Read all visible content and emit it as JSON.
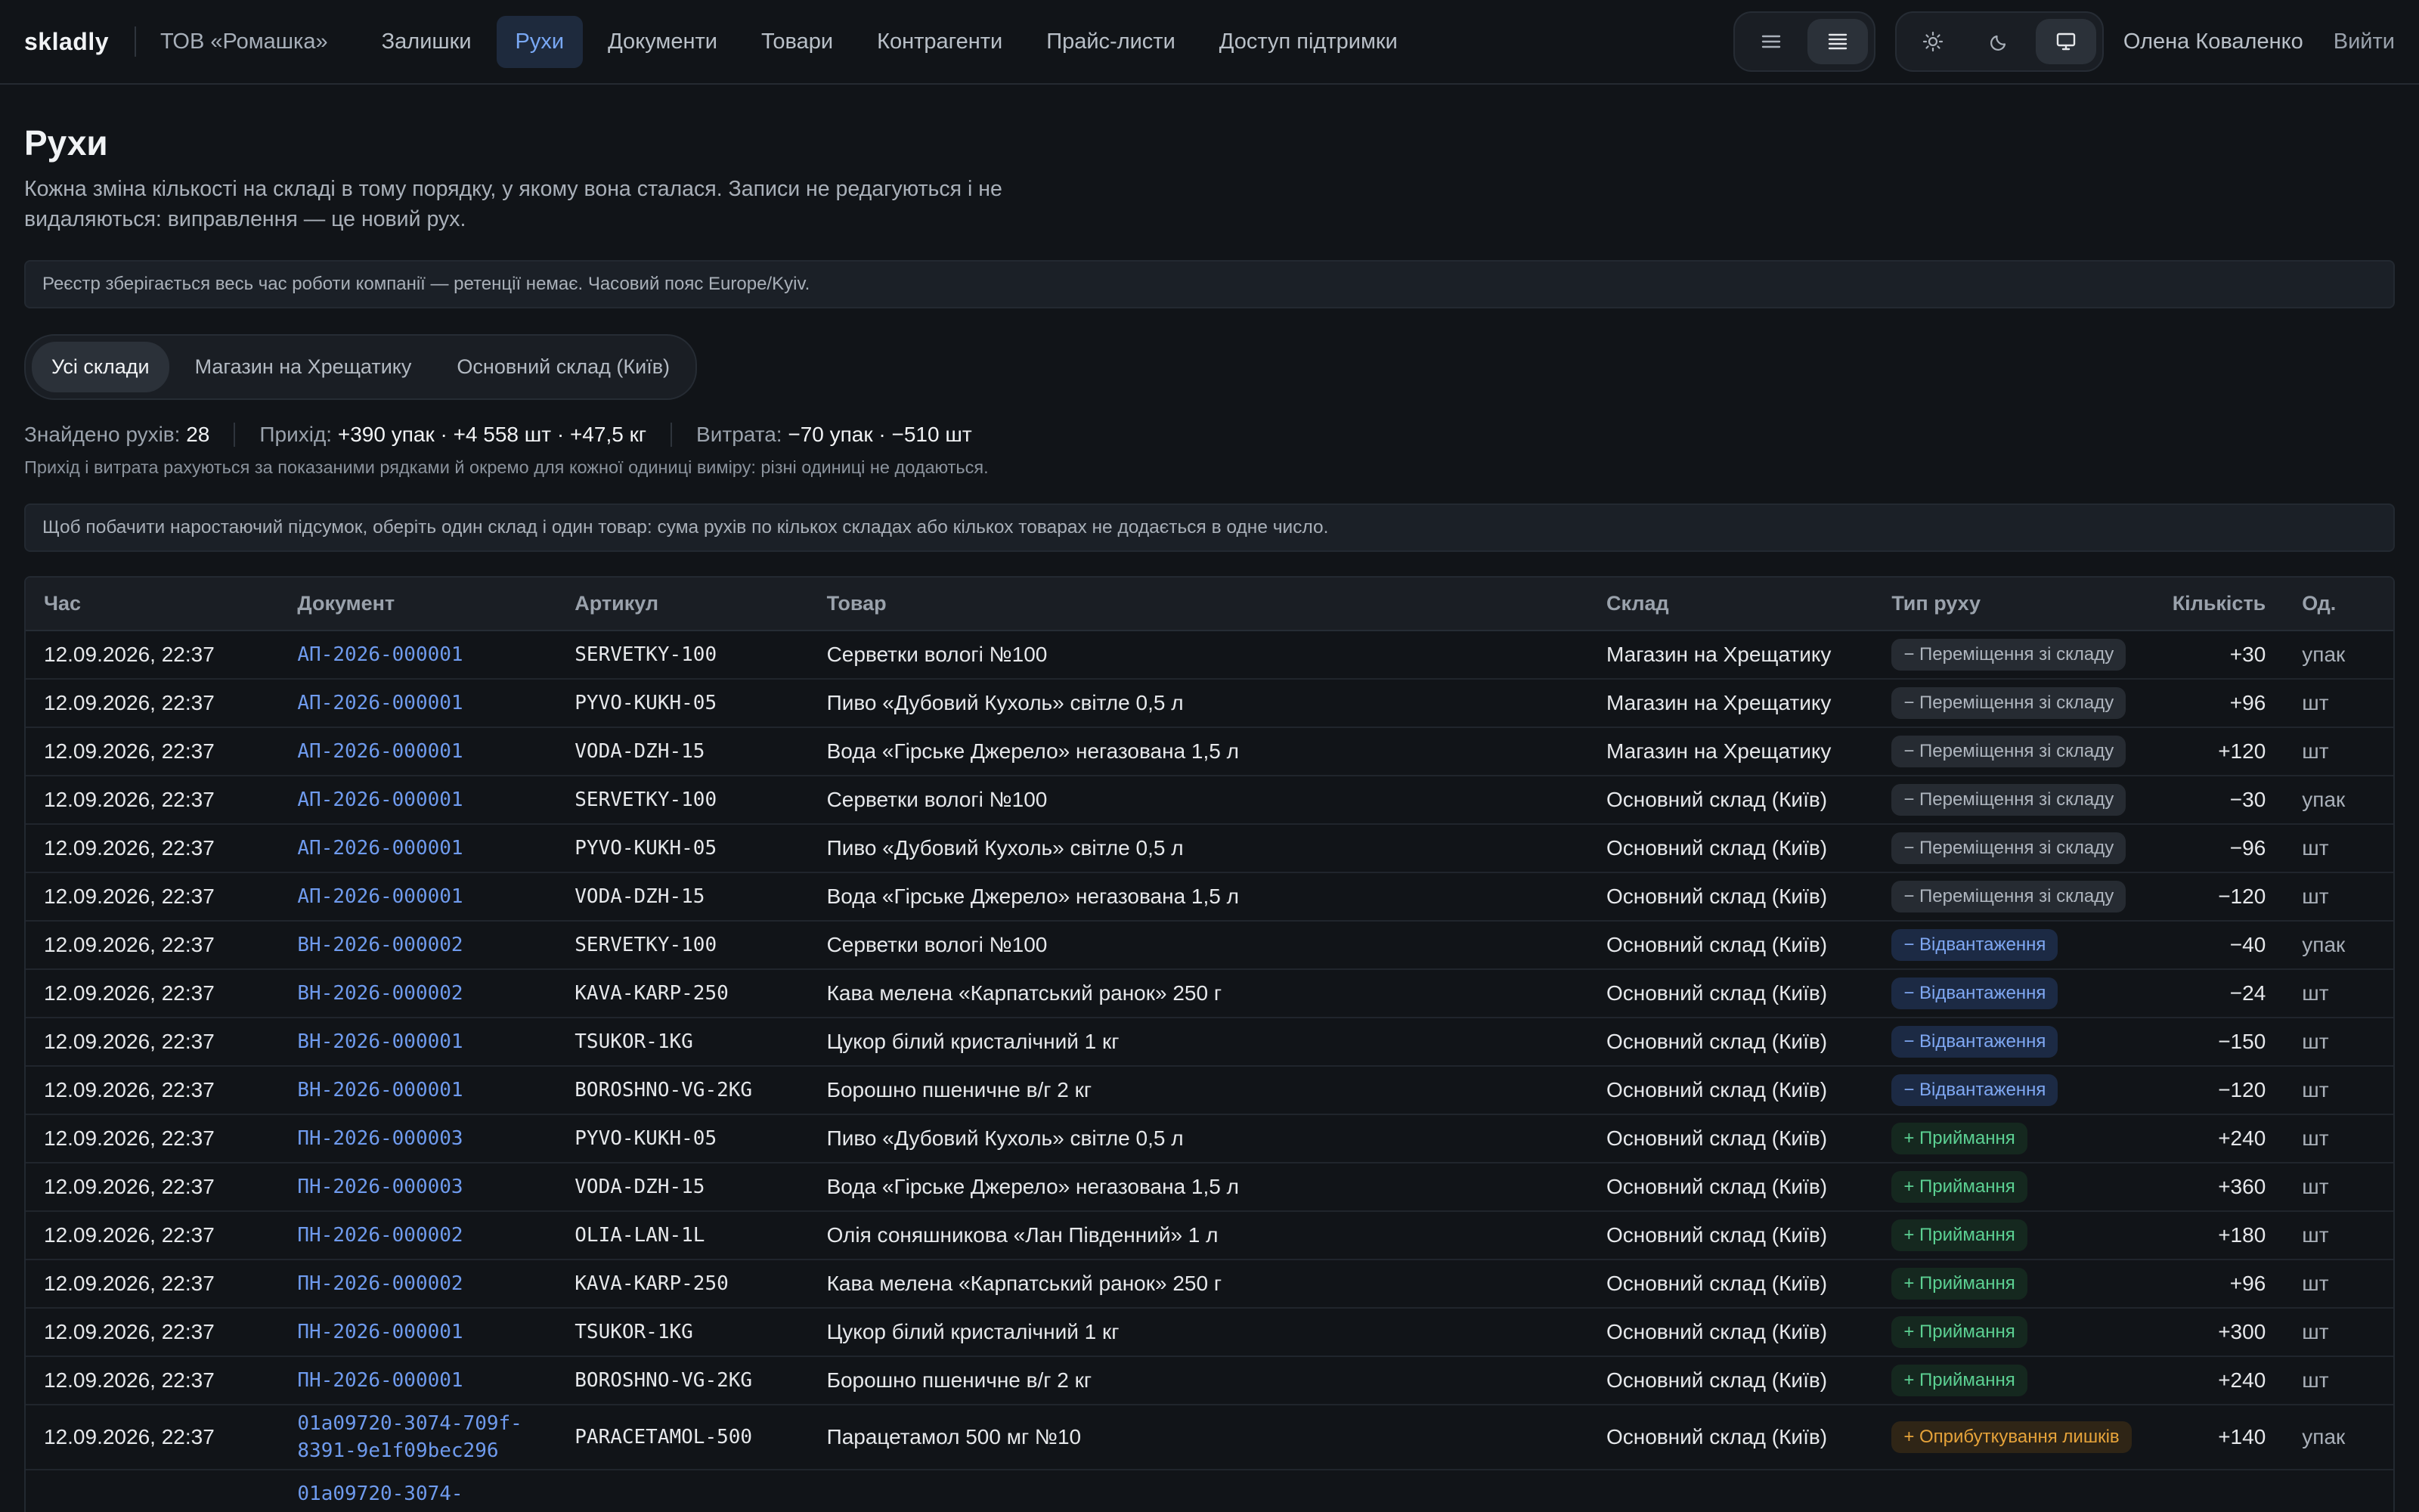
{
  "header": {
    "brand": "skladly",
    "company": "ТОВ «Ромашка»",
    "nav": [
      {
        "label": "Залишки",
        "active": false
      },
      {
        "label": "Рухи",
        "active": true
      },
      {
        "label": "Документи",
        "active": false
      },
      {
        "label": "Товари",
        "active": false
      },
      {
        "label": "Контрагенти",
        "active": false
      },
      {
        "label": "Прайс-листи",
        "active": false
      },
      {
        "label": "Доступ підтримки",
        "active": false
      }
    ],
    "density_icons": [
      "list-compact-icon",
      "list-dense-icon"
    ],
    "density_selected": "list-dense-icon",
    "theme_icons": [
      "sun-icon",
      "moon-icon",
      "monitor-icon"
    ],
    "theme_selected": "monitor-icon",
    "user": "Олена Коваленко",
    "logout": "Вийти"
  },
  "page": {
    "title": "Рухи",
    "subtitle": "Кожна зміна кількості на складі в тому порядку, у якому вона сталася. Записи не редагуються і не видаляються: виправлення — це новий рух.",
    "retention_notice": "Реєстр зберігається весь час роботи компанії — ретенції немає. Часовий пояс Europe/Kyiv.",
    "warehouse_tabs": [
      {
        "label": "Усі склади",
        "active": true
      },
      {
        "label": "Магазин на Хрещатику",
        "active": false
      },
      {
        "label": "Основний склад (Київ)",
        "active": false
      }
    ],
    "stats": {
      "found_label": "Знайдено рухів:",
      "found_value": "28",
      "income_label": "Прихід:",
      "income_value": "+390 упак · +4 558 шт · +47,5 кг",
      "expense_label": "Витрата:",
      "expense_value": "−70 упак · −510 шт"
    },
    "stats_note": "Прихід і витрата рахуються за показаними рядками й окремо для кожної одиниці виміру: різні одиниці не додаються.",
    "running_total_notice": "Щоб побачити наростаючий підсумок, оберіть один склад і один товар: сума рухів по кількох складах або кількох товарах не додається в одне число."
  },
  "table": {
    "columns": {
      "time": "Час",
      "document": "Документ",
      "sku": "Артикул",
      "product": "Товар",
      "warehouse": "Склад",
      "type": "Тип руху",
      "qty": "Кількість",
      "unit": "Од."
    },
    "rows": [
      {
        "time": "12.09.2026, 22:37",
        "document": "АП-2026-000001",
        "sku": "SERVETKY-100",
        "product": "Серветки вологі №100",
        "warehouse": "Магазин на Хрещатику",
        "type": "− Переміщення зі складу",
        "type_kind": "transfer",
        "qty": "+30",
        "unit": "упак"
      },
      {
        "time": "12.09.2026, 22:37",
        "document": "АП-2026-000001",
        "sku": "PYVO-KUKH-05",
        "product": "Пиво «Дубовий Кухоль» світле 0,5 л",
        "warehouse": "Магазин на Хрещатику",
        "type": "− Переміщення зі складу",
        "type_kind": "transfer",
        "qty": "+96",
        "unit": "шт"
      },
      {
        "time": "12.09.2026, 22:37",
        "document": "АП-2026-000001",
        "sku": "VODA-DZH-15",
        "product": "Вода «Гірське Джерело» негазована 1,5 л",
        "warehouse": "Магазин на Хрещатику",
        "type": "− Переміщення зі складу",
        "type_kind": "transfer",
        "qty": "+120",
        "unit": "шт"
      },
      {
        "time": "12.09.2026, 22:37",
        "document": "АП-2026-000001",
        "sku": "SERVETKY-100",
        "product": "Серветки вологі №100",
        "warehouse": "Основний склад (Київ)",
        "type": "− Переміщення зі складу",
        "type_kind": "transfer",
        "qty": "−30",
        "unit": "упак"
      },
      {
        "time": "12.09.2026, 22:37",
        "document": "АП-2026-000001",
        "sku": "PYVO-KUKH-05",
        "product": "Пиво «Дубовий Кухоль» світле 0,5 л",
        "warehouse": "Основний склад (Київ)",
        "type": "− Переміщення зі складу",
        "type_kind": "transfer",
        "qty": "−96",
        "unit": "шт"
      },
      {
        "time": "12.09.2026, 22:37",
        "document": "АП-2026-000001",
        "sku": "VODA-DZH-15",
        "product": "Вода «Гірське Джерело» негазована 1,5 л",
        "warehouse": "Основний склад (Київ)",
        "type": "− Переміщення зі складу",
        "type_kind": "transfer",
        "qty": "−120",
        "unit": "шт"
      },
      {
        "time": "12.09.2026, 22:37",
        "document": "ВН-2026-000002",
        "sku": "SERVETKY-100",
        "product": "Серветки вологі №100",
        "warehouse": "Основний склад (Київ)",
        "type": "− Відвантаження",
        "type_kind": "ship",
        "qty": "−40",
        "unit": "упак"
      },
      {
        "time": "12.09.2026, 22:37",
        "document": "ВН-2026-000002",
        "sku": "KAVA-KARP-250",
        "product": "Кава мелена «Карпатський ранок» 250 г",
        "warehouse": "Основний склад (Київ)",
        "type": "− Відвантаження",
        "type_kind": "ship",
        "qty": "−24",
        "unit": "шт"
      },
      {
        "time": "12.09.2026, 22:37",
        "document": "ВН-2026-000001",
        "sku": "TSUKOR-1KG",
        "product": "Цукор білий кристалічний 1 кг",
        "warehouse": "Основний склад (Київ)",
        "type": "− Відвантаження",
        "type_kind": "ship",
        "qty": "−150",
        "unit": "шт"
      },
      {
        "time": "12.09.2026, 22:37",
        "document": "ВН-2026-000001",
        "sku": "BOROSHNO-VG-2KG",
        "product": "Борошно пшеничне в/г 2 кг",
        "warehouse": "Основний склад (Київ)",
        "type": "− Відвантаження",
        "type_kind": "ship",
        "qty": "−120",
        "unit": "шт"
      },
      {
        "time": "12.09.2026, 22:37",
        "document": "ПН-2026-000003",
        "sku": "PYVO-KUKH-05",
        "product": "Пиво «Дубовий Кухоль» світле 0,5 л",
        "warehouse": "Основний склад (Київ)",
        "type": "+ Приймання",
        "type_kind": "receive",
        "qty": "+240",
        "unit": "шт"
      },
      {
        "time": "12.09.2026, 22:37",
        "document": "ПН-2026-000003",
        "sku": "VODA-DZH-15",
        "product": "Вода «Гірське Джерело» негазована 1,5 л",
        "warehouse": "Основний склад (Київ)",
        "type": "+ Приймання",
        "type_kind": "receive",
        "qty": "+360",
        "unit": "шт"
      },
      {
        "time": "12.09.2026, 22:37",
        "document": "ПН-2026-000002",
        "sku": "OLIA-LAN-1L",
        "product": "Олія соняшникова «Лан Південний» 1 л",
        "warehouse": "Основний склад (Київ)",
        "type": "+ Приймання",
        "type_kind": "receive",
        "qty": "+180",
        "unit": "шт"
      },
      {
        "time": "12.09.2026, 22:37",
        "document": "ПН-2026-000002",
        "sku": "KAVA-KARP-250",
        "product": "Кава мелена «Карпатський ранок» 250 г",
        "warehouse": "Основний склад (Київ)",
        "type": "+ Приймання",
        "type_kind": "receive",
        "qty": "+96",
        "unit": "шт"
      },
      {
        "time": "12.09.2026, 22:37",
        "document": "ПН-2026-000001",
        "sku": "TSUKOR-1KG",
        "product": "Цукор білий кристалічний 1 кг",
        "warehouse": "Основний склад (Київ)",
        "type": "+ Приймання",
        "type_kind": "receive",
        "qty": "+300",
        "unit": "шт"
      },
      {
        "time": "12.09.2026, 22:37",
        "document": "ПН-2026-000001",
        "sku": "BOROSHNO-VG-2KG",
        "product": "Борошно пшеничне в/г 2 кг",
        "warehouse": "Основний склад (Київ)",
        "type": "+ Приймання",
        "type_kind": "receive",
        "qty": "+240",
        "unit": "шт"
      },
      {
        "time": "12.09.2026, 22:37",
        "document": "01a09720-3074-709f-8391-9e1f09bec296",
        "sku": "PARACETAMOL-500",
        "product": "Парацетамол 500 мг №10",
        "warehouse": "Основний склад (Київ)",
        "type": "+ Оприбуткування лишків",
        "type_kind": "surplus",
        "qty": "+140",
        "unit": "упак"
      },
      {
        "time": "",
        "document": "01a09720-3074-",
        "sku": "",
        "product": "",
        "warehouse": "",
        "type": "",
        "type_kind": "surplus",
        "qty": "",
        "unit": ""
      }
    ]
  },
  "colors": {
    "background": "#111418",
    "accent_link": "#6f9bee",
    "transfer": "#aeb5be",
    "ship": "#7fa8f3",
    "receive": "#5cd193",
    "surplus": "#e6a33a"
  }
}
